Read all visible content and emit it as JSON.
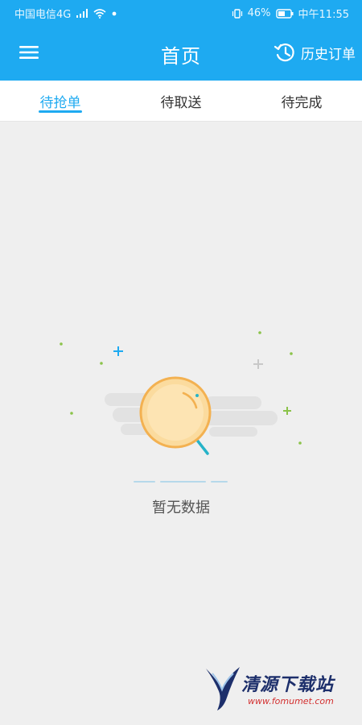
{
  "status_bar": {
    "carrier": "中国电信4G",
    "battery": "46%",
    "time": "中午11:55"
  },
  "header": {
    "title": "首页",
    "history_label": "历史订单",
    "menu_icon": "hamburger-menu-icon",
    "history_icon": "history-clock-icon"
  },
  "tabs": [
    {
      "label": "待抢单",
      "active": true
    },
    {
      "label": "待取送",
      "active": false
    },
    {
      "label": "待完成",
      "active": false
    }
  ],
  "empty_state": {
    "message": "暂无数据",
    "icon": "magnifier-empty-icon"
  },
  "watermark": {
    "text": "清源下载站",
    "sub": "www.fomumet.com"
  },
  "colors": {
    "primary": "#1eaaf1",
    "background": "#efefef",
    "tab_bg": "#ffffff",
    "text_dark": "#333333",
    "text_muted": "#555555"
  }
}
